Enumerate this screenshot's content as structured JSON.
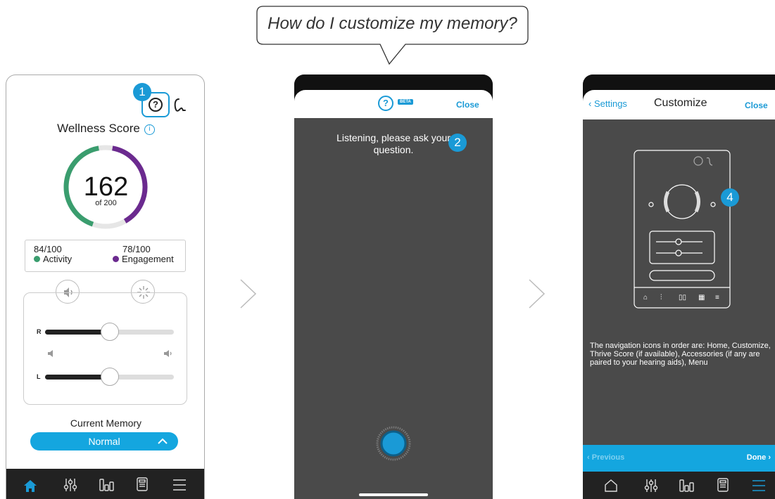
{
  "bubble": {
    "question": "How do I customize my memory?"
  },
  "phone1": {
    "step_badge": "1",
    "title": "Wellness Score",
    "info_glyph": "i",
    "score": {
      "value": "162",
      "sub": "of 200",
      "activity_fraction": 0.42,
      "engagement_fraction": 0.39
    },
    "stats": {
      "activity": {
        "value": "84/100",
        "label": "Activity",
        "color": "#3a9d6e"
      },
      "engagement": {
        "value": "78/100",
        "label": "Engagement",
        "color": "#6b2a8f"
      }
    },
    "volume": {
      "right_label": "R",
      "left_label": "L",
      "right_level": 0.5,
      "left_level": 0.5
    },
    "current_memory": {
      "heading": "Current Memory",
      "value": "Normal"
    },
    "nav": {
      "items": [
        "home-icon",
        "sliders-icon",
        "chart-icon",
        "remote-icon",
        "menu-icon"
      ],
      "active": "home-icon"
    }
  },
  "phone2": {
    "beta": "BETA",
    "close": "Close",
    "listening": "Listening, please ask your question.",
    "step_badge": "2"
  },
  "phone3": {
    "back": "Settings",
    "title": "Customize",
    "close": "Close",
    "step_badge": "4",
    "description": "The navigation icons in order are: Home, Customize, Thrive Score (if available), Accessories (if any are paired to your hearing aids), Menu",
    "previous": "Previous",
    "done": "Done",
    "nav": {
      "items": [
        "home-icon",
        "sliders-icon",
        "chart-icon",
        "remote-icon",
        "menu-icon"
      ],
      "active": "menu-icon"
    }
  },
  "colors": {
    "accent": "#1a9ad6",
    "pill": "#14a6df",
    "dark": "#222222",
    "panel": "#4a4a4a"
  }
}
